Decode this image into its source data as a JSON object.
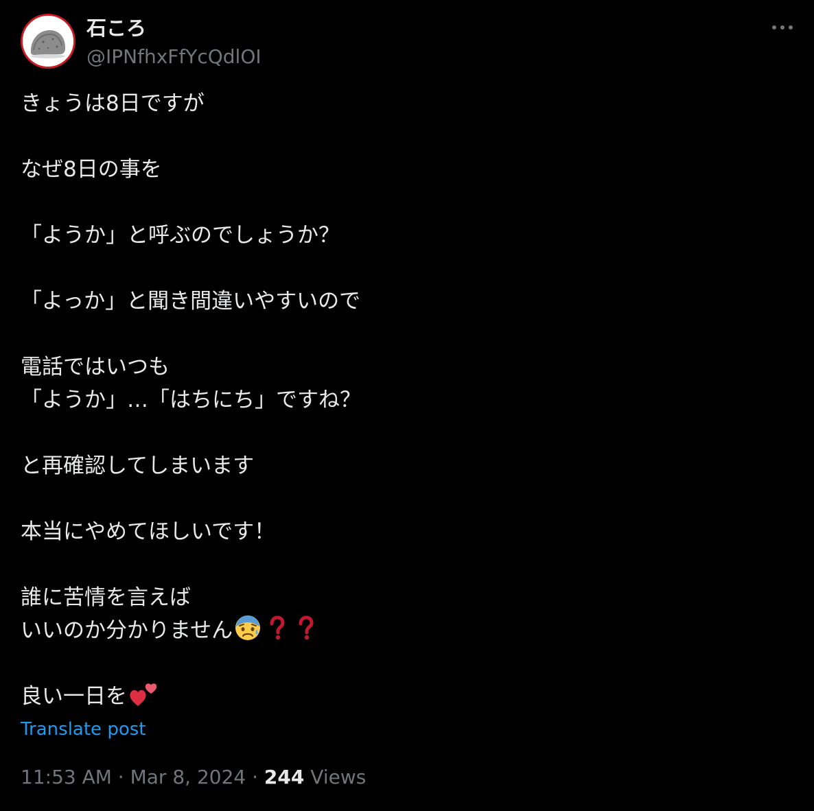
{
  "author": {
    "display_name": "石ころ",
    "handle": "@IPNfhxFfYcQdlOI",
    "avatar_icon": "stone-avatar-icon"
  },
  "more_icon": "more-horizontal-icon",
  "post": {
    "lines": [
      "きょうは8日ですが",
      "",
      "なぜ8日の事を",
      "",
      "「ようか」と呼ぶのでしょうか？",
      "",
      "「よっか」と聞き間違いやすいので",
      "",
      "電話ではいつも",
      "「ようか」…「はちにち」ですね？",
      "",
      "と再確認してしまいます",
      "",
      "本当にやめてほしいです！",
      "",
      "誰に苦情を言えば",
      "いいのか分かりません",
      "",
      "良い一日を"
    ],
    "emoji": {
      "worried_face": "anxious-face-icon",
      "question_marks": "red-question-mark-icon",
      "hearts": "two-hearts-icon"
    }
  },
  "translate_label": "Translate post",
  "meta": {
    "time": "11:53 AM",
    "separator": " · ",
    "date": "Mar 8, 2024",
    "views_count": "244",
    "views_label": " Views"
  },
  "colors": {
    "background": "#000000",
    "text": "#e7e9ea",
    "muted": "#71767b",
    "link": "#1d9bf0",
    "avatar_border": "#c91c24"
  }
}
